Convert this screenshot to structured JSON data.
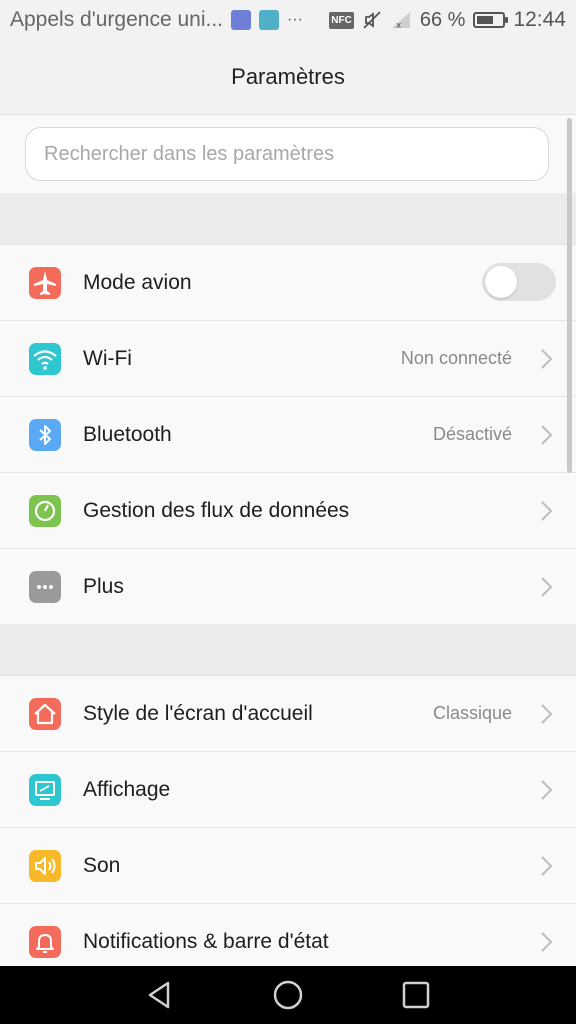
{
  "status_bar": {
    "notification_text": "Appels d'urgence uni...",
    "more_glyph": "···",
    "nfc_label": "NFC",
    "battery_percent": "66 %",
    "battery_level": 0.66,
    "time": "12:44"
  },
  "header": {
    "title": "Paramètres"
  },
  "search": {
    "placeholder": "Rechercher dans les paramètres",
    "value": ""
  },
  "groups": [
    {
      "items": [
        {
          "label": "Mode avion",
          "value": "",
          "icon": "airplane-icon",
          "color": "#f26b5b",
          "control": "toggle",
          "toggle_on": false
        },
        {
          "label": "Wi-Fi",
          "value": "Non connecté",
          "icon": "wifi-icon",
          "color": "#2ec6cf",
          "control": "chevron"
        },
        {
          "label": "Bluetooth",
          "value": "Désactivé",
          "icon": "bluetooth-icon",
          "color": "#5aa9f5",
          "control": "chevron"
        },
        {
          "label": "Gestion des flux de données",
          "value": "",
          "icon": "data-usage-icon",
          "color": "#7dc34f",
          "control": "chevron"
        },
        {
          "label": "Plus",
          "value": "",
          "icon": "more-icon",
          "color": "#9a9a9a",
          "control": "chevron"
        }
      ]
    },
    {
      "items": [
        {
          "label": "Style de l'écran d'accueil",
          "value": "Classique",
          "icon": "home-icon",
          "color": "#f26b5b",
          "control": "chevron"
        },
        {
          "label": "Affichage",
          "value": "",
          "icon": "display-icon",
          "color": "#2ec6cf",
          "control": "chevron"
        },
        {
          "label": "Son",
          "value": "",
          "icon": "sound-icon",
          "color": "#f7b928",
          "control": "chevron"
        },
        {
          "label": "Notifications & barre d'état",
          "value": "",
          "icon": "notification-bell-icon",
          "color": "#f26b5b",
          "control": "chevron"
        }
      ]
    }
  ]
}
